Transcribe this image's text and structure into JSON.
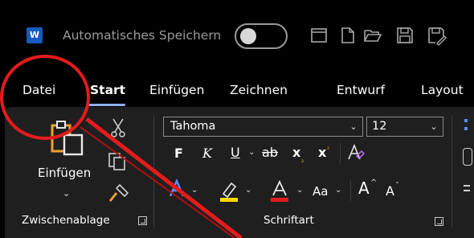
{
  "titlebar": {
    "app_badge": "W",
    "autosave_label": "Automatisches Speichern",
    "icons": [
      "frame-icon",
      "new-document-icon",
      "open-folder-icon",
      "save-icon",
      "save-as-icon"
    ]
  },
  "tabs": [
    {
      "label": "Datei",
      "active": false
    },
    {
      "label": "Start",
      "active": true
    },
    {
      "label": "Einfügen",
      "active": false
    },
    {
      "label": "Zeichnen",
      "active": false
    },
    {
      "label": "Entwurf",
      "active": false
    },
    {
      "label": "Layout",
      "active": false
    }
  ],
  "clipboard": {
    "paste_label": "Einfügen",
    "group_label": "Zwischenablage"
  },
  "font": {
    "font_name": "Tahoma",
    "font_size": "12",
    "bold": "F",
    "italic": "K",
    "underline": "U",
    "strikethrough": "ab",
    "subscript": "x",
    "superscript": "x",
    "change_case": "Aa",
    "grow": "A",
    "shrink": "A",
    "group_label": "Schriftart",
    "highlight_color": "#ffd700",
    "font_color": "#e41b1b"
  },
  "colors": {
    "accent_underline": "#8fb0ff",
    "annotation_red": "#e41b1b"
  }
}
